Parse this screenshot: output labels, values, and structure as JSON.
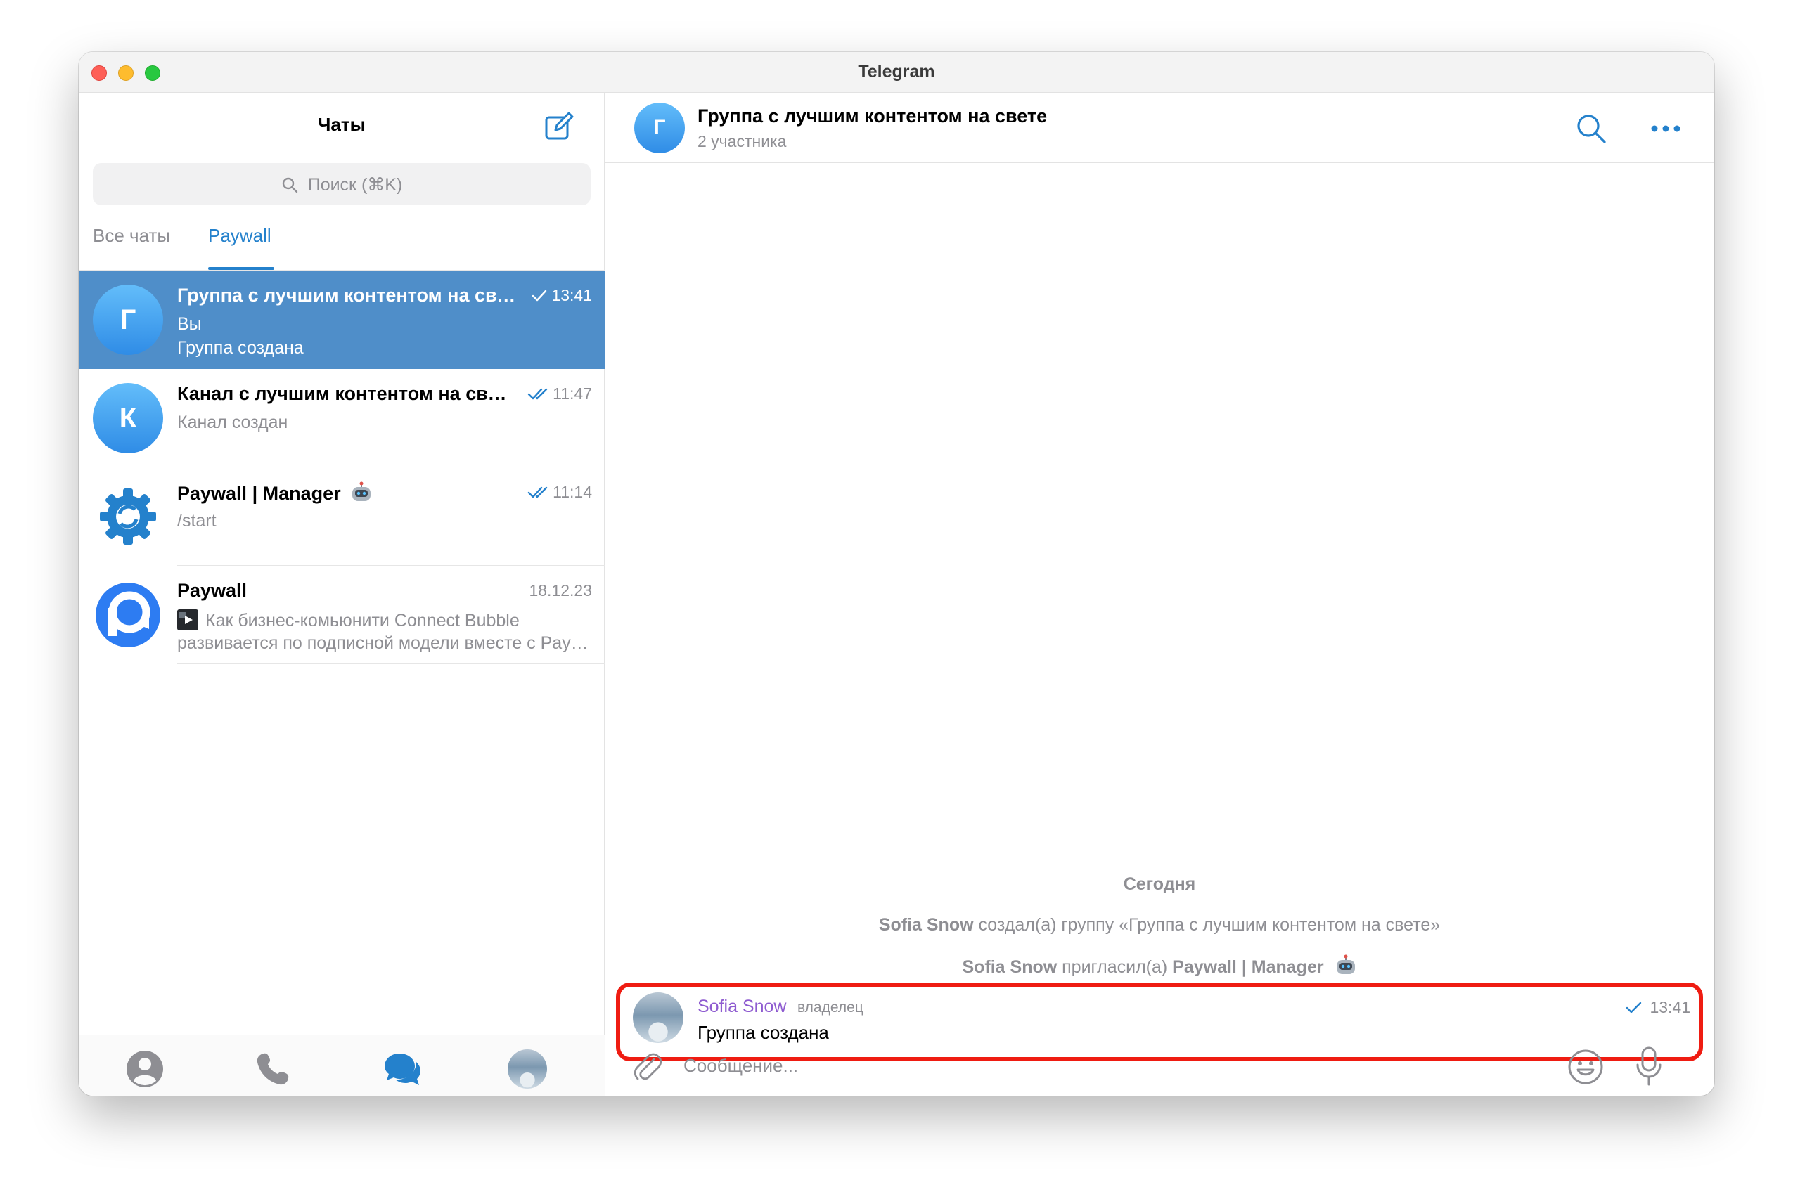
{
  "window": {
    "title": "Telegram"
  },
  "sidebar": {
    "title": "Чаты",
    "search_placeholder": "Поиск (⌘K)",
    "tabs": [
      {
        "label": "Все чаты"
      },
      {
        "label": "Paywall"
      }
    ],
    "chats": [
      {
        "avatar_letter": "Г",
        "title": "Группа с лучшим контентом на свете",
        "time": "13:41",
        "line1": "Вы",
        "line2": "Группа создана",
        "status": "single-check",
        "active": true
      },
      {
        "avatar_letter": "К",
        "title": "Канал с лучшим контентом на свете",
        "time": "11:47",
        "line1": "Канал создан",
        "status": "double-check"
      },
      {
        "title": "Paywall | Manager",
        "badge_icon": "robot-icon",
        "time": "11:14",
        "line1": "/start",
        "status": "double-check",
        "avatar_icon": "gear-sync-icon"
      },
      {
        "title": "Paywall",
        "time": "18.12.23",
        "line1": "Как бизнес-комьюнити Connect Bubble",
        "line2": "развивается по подписной модели вместе с Paywall",
        "media_icon": "video-thumbnail-icon",
        "avatar_icon": "paywall-logo-icon"
      }
    ],
    "bottom_nav": [
      "contacts-icon",
      "calls-icon",
      "chats-icon",
      "profile-avatar"
    ]
  },
  "chat": {
    "avatar_letter": "Г",
    "title": "Группа с лучшим контентом на свете",
    "subtitle": "2 участника",
    "day_label": "Сегодня",
    "service_messages": [
      {
        "name": "Sofia Snow",
        "text": " создал(а) группу «Группа с лучшим контентом на свете»"
      },
      {
        "name": "Sofia Snow",
        "text": " пригласил(а) ",
        "target": "Paywall | Manager"
      }
    ],
    "message": {
      "author": "Sofia Snow",
      "role": "владелец",
      "text": "Группа создана",
      "time": "13:41",
      "status": "single-check"
    },
    "composer_placeholder": "Сообщение..."
  },
  "colors": {
    "accent": "#2481cc",
    "active_row": "#4f8ec9",
    "highlight": "#ef1c12",
    "author": "#8e5bd0"
  }
}
